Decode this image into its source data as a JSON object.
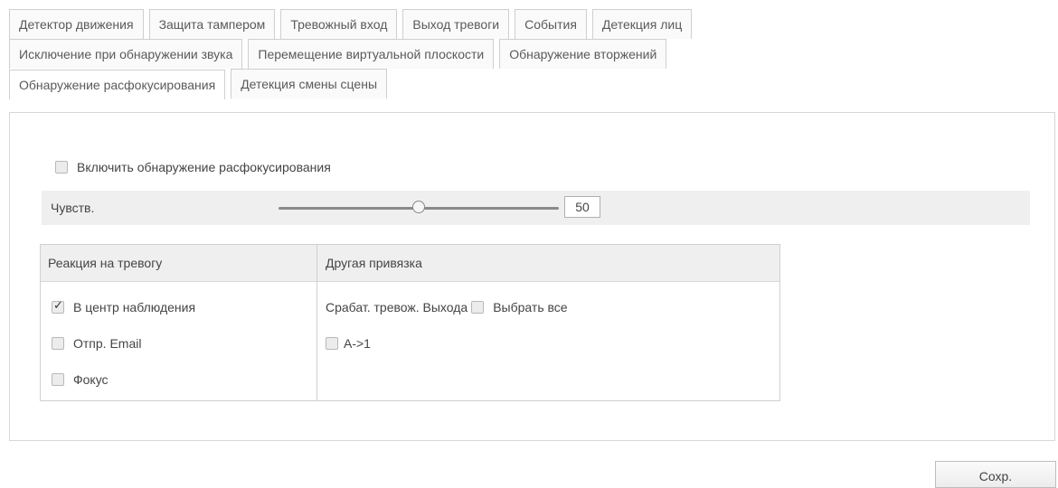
{
  "tabs": {
    "row1": [
      "Детектор движения",
      "Защита тампером",
      "Тревожный вход",
      "Выход тревоги",
      "События",
      "Детекция лиц"
    ],
    "row2": [
      "Исключение при обнаружении звука",
      "Перемещение виртуальной плоскости",
      "Обнаружение вторжений"
    ],
    "row3": [
      "Обнаружение расфокусирования",
      "Детекция смены сцены"
    ],
    "active": "Обнаружение расфокусирования"
  },
  "enable": {
    "label": "Включить обнаружение расфокусирования",
    "checked": false
  },
  "sensitivity": {
    "label": "Чувств.",
    "value": "50",
    "level_percent": 50
  },
  "linkage": {
    "alarm_reaction_header": "Реакция на тревогу",
    "other_linkage_header": "Другая привязка",
    "alarm_actions": [
      {
        "label": "В центр наблюдения",
        "checked": true
      },
      {
        "label": "Отпр. Email",
        "checked": false
      },
      {
        "label": "Фокус",
        "checked": false
      }
    ],
    "trigger_output_label": "Срабат. тревож. Выхода",
    "select_all_label": "Выбрать все",
    "select_all_checked": false,
    "outputs": [
      {
        "label": "A->1",
        "checked": false
      }
    ]
  },
  "save_label": "Сохр."
}
